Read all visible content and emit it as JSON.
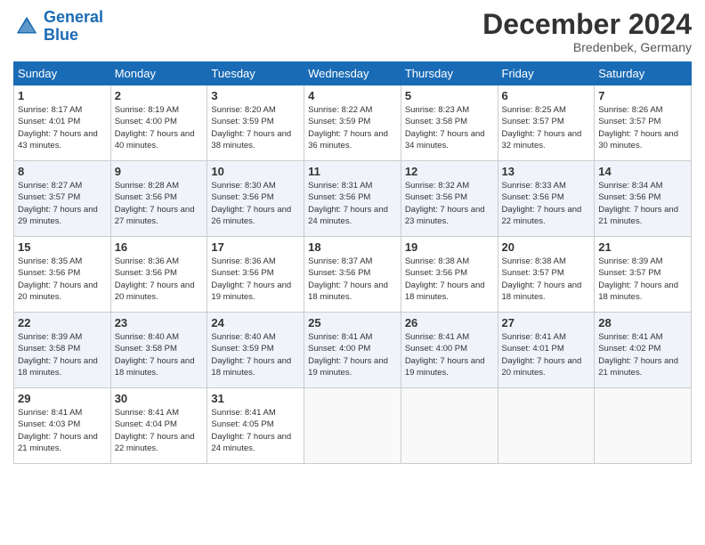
{
  "header": {
    "logo_general": "General",
    "logo_blue": "Blue",
    "month_title": "December 2024",
    "location": "Bredenbek, Germany"
  },
  "days_of_week": [
    "Sunday",
    "Monday",
    "Tuesday",
    "Wednesday",
    "Thursday",
    "Friday",
    "Saturday"
  ],
  "weeks": [
    [
      {
        "day": "1",
        "sunrise": "Sunrise: 8:17 AM",
        "sunset": "Sunset: 4:01 PM",
        "daylight": "Daylight: 7 hours and 43 minutes."
      },
      {
        "day": "2",
        "sunrise": "Sunrise: 8:19 AM",
        "sunset": "Sunset: 4:00 PM",
        "daylight": "Daylight: 7 hours and 40 minutes."
      },
      {
        "day": "3",
        "sunrise": "Sunrise: 8:20 AM",
        "sunset": "Sunset: 3:59 PM",
        "daylight": "Daylight: 7 hours and 38 minutes."
      },
      {
        "day": "4",
        "sunrise": "Sunrise: 8:22 AM",
        "sunset": "Sunset: 3:59 PM",
        "daylight": "Daylight: 7 hours and 36 minutes."
      },
      {
        "day": "5",
        "sunrise": "Sunrise: 8:23 AM",
        "sunset": "Sunset: 3:58 PM",
        "daylight": "Daylight: 7 hours and 34 minutes."
      },
      {
        "day": "6",
        "sunrise": "Sunrise: 8:25 AM",
        "sunset": "Sunset: 3:57 PM",
        "daylight": "Daylight: 7 hours and 32 minutes."
      },
      {
        "day": "7",
        "sunrise": "Sunrise: 8:26 AM",
        "sunset": "Sunset: 3:57 PM",
        "daylight": "Daylight: 7 hours and 30 minutes."
      }
    ],
    [
      {
        "day": "8",
        "sunrise": "Sunrise: 8:27 AM",
        "sunset": "Sunset: 3:57 PM",
        "daylight": "Daylight: 7 hours and 29 minutes."
      },
      {
        "day": "9",
        "sunrise": "Sunrise: 8:28 AM",
        "sunset": "Sunset: 3:56 PM",
        "daylight": "Daylight: 7 hours and 27 minutes."
      },
      {
        "day": "10",
        "sunrise": "Sunrise: 8:30 AM",
        "sunset": "Sunset: 3:56 PM",
        "daylight": "Daylight: 7 hours and 26 minutes."
      },
      {
        "day": "11",
        "sunrise": "Sunrise: 8:31 AM",
        "sunset": "Sunset: 3:56 PM",
        "daylight": "Daylight: 7 hours and 24 minutes."
      },
      {
        "day": "12",
        "sunrise": "Sunrise: 8:32 AM",
        "sunset": "Sunset: 3:56 PM",
        "daylight": "Daylight: 7 hours and 23 minutes."
      },
      {
        "day": "13",
        "sunrise": "Sunrise: 8:33 AM",
        "sunset": "Sunset: 3:56 PM",
        "daylight": "Daylight: 7 hours and 22 minutes."
      },
      {
        "day": "14",
        "sunrise": "Sunrise: 8:34 AM",
        "sunset": "Sunset: 3:56 PM",
        "daylight": "Daylight: 7 hours and 21 minutes."
      }
    ],
    [
      {
        "day": "15",
        "sunrise": "Sunrise: 8:35 AM",
        "sunset": "Sunset: 3:56 PM",
        "daylight": "Daylight: 7 hours and 20 minutes."
      },
      {
        "day": "16",
        "sunrise": "Sunrise: 8:36 AM",
        "sunset": "Sunset: 3:56 PM",
        "daylight": "Daylight: 7 hours and 20 minutes."
      },
      {
        "day": "17",
        "sunrise": "Sunrise: 8:36 AM",
        "sunset": "Sunset: 3:56 PM",
        "daylight": "Daylight: 7 hours and 19 minutes."
      },
      {
        "day": "18",
        "sunrise": "Sunrise: 8:37 AM",
        "sunset": "Sunset: 3:56 PM",
        "daylight": "Daylight: 7 hours and 18 minutes."
      },
      {
        "day": "19",
        "sunrise": "Sunrise: 8:38 AM",
        "sunset": "Sunset: 3:56 PM",
        "daylight": "Daylight: 7 hours and 18 minutes."
      },
      {
        "day": "20",
        "sunrise": "Sunrise: 8:38 AM",
        "sunset": "Sunset: 3:57 PM",
        "daylight": "Daylight: 7 hours and 18 minutes."
      },
      {
        "day": "21",
        "sunrise": "Sunrise: 8:39 AM",
        "sunset": "Sunset: 3:57 PM",
        "daylight": "Daylight: 7 hours and 18 minutes."
      }
    ],
    [
      {
        "day": "22",
        "sunrise": "Sunrise: 8:39 AM",
        "sunset": "Sunset: 3:58 PM",
        "daylight": "Daylight: 7 hours and 18 minutes."
      },
      {
        "day": "23",
        "sunrise": "Sunrise: 8:40 AM",
        "sunset": "Sunset: 3:58 PM",
        "daylight": "Daylight: 7 hours and 18 minutes."
      },
      {
        "day": "24",
        "sunrise": "Sunrise: 8:40 AM",
        "sunset": "Sunset: 3:59 PM",
        "daylight": "Daylight: 7 hours and 18 minutes."
      },
      {
        "day": "25",
        "sunrise": "Sunrise: 8:41 AM",
        "sunset": "Sunset: 4:00 PM",
        "daylight": "Daylight: 7 hours and 19 minutes."
      },
      {
        "day": "26",
        "sunrise": "Sunrise: 8:41 AM",
        "sunset": "Sunset: 4:00 PM",
        "daylight": "Daylight: 7 hours and 19 minutes."
      },
      {
        "day": "27",
        "sunrise": "Sunrise: 8:41 AM",
        "sunset": "Sunset: 4:01 PM",
        "daylight": "Daylight: 7 hours and 20 minutes."
      },
      {
        "day": "28",
        "sunrise": "Sunrise: 8:41 AM",
        "sunset": "Sunset: 4:02 PM",
        "daylight": "Daylight: 7 hours and 21 minutes."
      }
    ],
    [
      {
        "day": "29",
        "sunrise": "Sunrise: 8:41 AM",
        "sunset": "Sunset: 4:03 PM",
        "daylight": "Daylight: 7 hours and 21 minutes."
      },
      {
        "day": "30",
        "sunrise": "Sunrise: 8:41 AM",
        "sunset": "Sunset: 4:04 PM",
        "daylight": "Daylight: 7 hours and 22 minutes."
      },
      {
        "day": "31",
        "sunrise": "Sunrise: 8:41 AM",
        "sunset": "Sunset: 4:05 PM",
        "daylight": "Daylight: 7 hours and 24 minutes."
      },
      null,
      null,
      null,
      null
    ]
  ]
}
